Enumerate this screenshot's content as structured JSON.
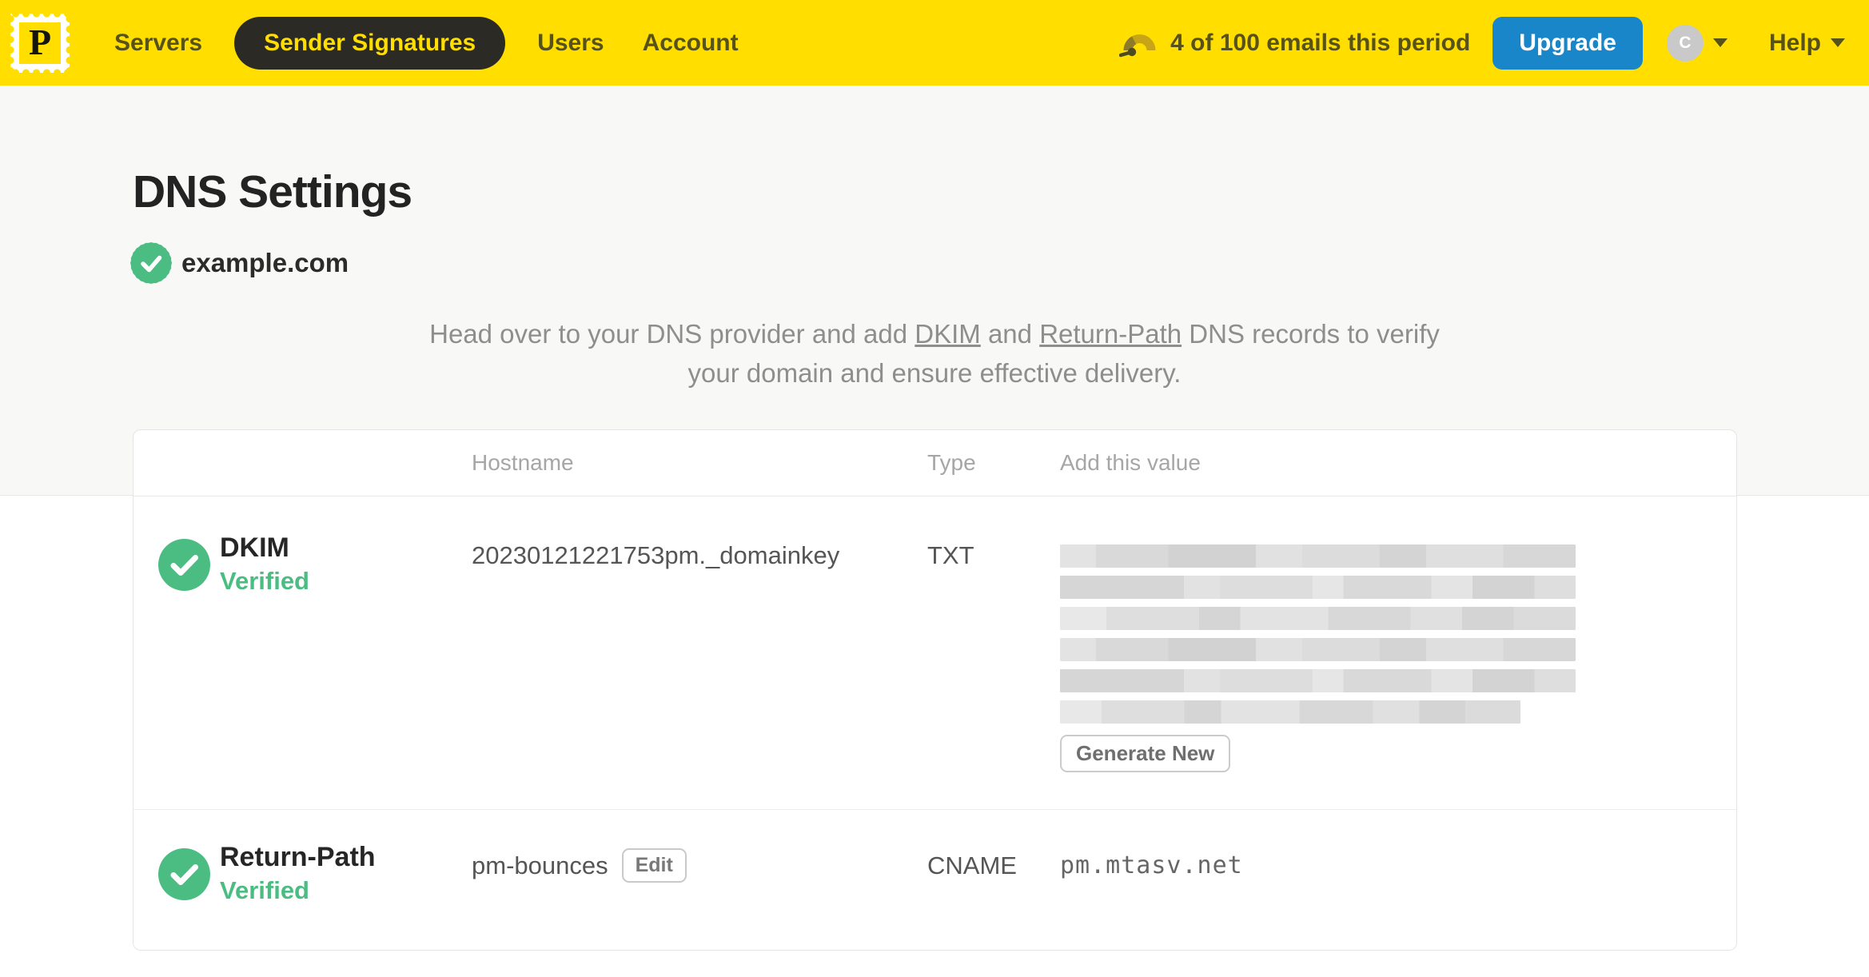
{
  "colors": {
    "brand_yellow": "#FFDE00",
    "nav_text_dark_olive": "#57511A",
    "active_pill_bg": "#2B2A24",
    "accent_blue": "#1886C9",
    "success_green": "#4CBD82",
    "hero_bg": "#F8F8F7"
  },
  "navbar": {
    "logo_letter": "P",
    "items": [
      {
        "label": "Servers",
        "active": false
      },
      {
        "label": "Sender Signatures",
        "active": true
      },
      {
        "label": "Users",
        "active": false
      },
      {
        "label": "Account",
        "active": false
      }
    ],
    "usage_text": "4 of 100 emails this period",
    "upgrade_label": "Upgrade",
    "avatar_initial": "C",
    "help_label": "Help"
  },
  "page": {
    "title": "DNS Settings",
    "domain": "example.com",
    "intro": {
      "part1": "Head over to your DNS provider and add ",
      "link_dkim": "DKIM",
      "part2": " and ",
      "link_return_path": "Return-Path",
      "part3": " DNS records to verify your domain and ensure effective delivery."
    }
  },
  "table": {
    "headers": {
      "hostname": "Hostname",
      "type": "Type",
      "value": "Add this value"
    },
    "records": [
      {
        "name": "DKIM",
        "status": "Verified",
        "hostname": "20230121221753pm._domainkey",
        "type": "TXT",
        "value_redacted": true,
        "redacted_lines": 6,
        "action_label": "Generate New"
      },
      {
        "name": "Return-Path",
        "status": "Verified",
        "hostname": "pm-bounces",
        "edit_label": "Edit",
        "type": "CNAME",
        "value": "pm.mtasv.net"
      }
    ]
  }
}
